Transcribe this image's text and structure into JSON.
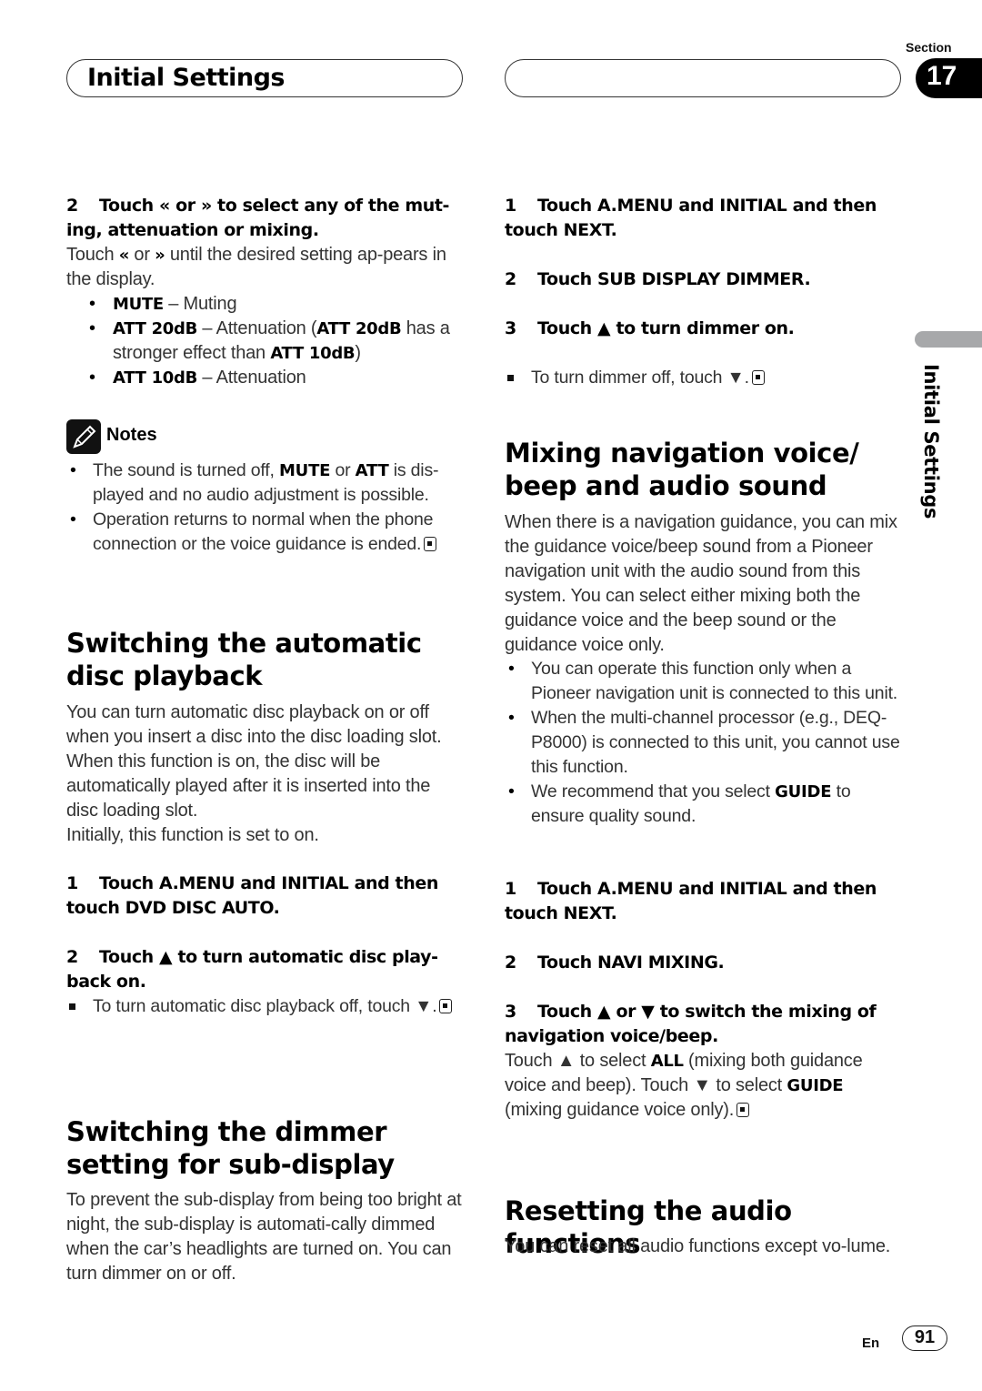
{
  "header": {
    "title": "Initial Settings",
    "section_label": "Section",
    "section_number": "17"
  },
  "side_tab": {
    "label": "Initial Settings"
  },
  "left_column": {
    "step2": {
      "num": "2",
      "text_a": "Touch ",
      "icon_prev": "«",
      "text_b": " or ",
      "icon_next": "»",
      "text_c": " to select any of the mut-ing, attenuation or mixing."
    },
    "step2_body": {
      "a": "Touch ",
      "prev": "«",
      "b": " or ",
      "next": "»",
      "c": " until the desired setting ap-pears in the display."
    },
    "options": [
      {
        "term": "MUTE",
        "desc": " – Muting"
      },
      {
        "term": "ATT 20dB",
        "desc": " – Attenuation (",
        "term2": "ATT 20dB",
        "desc2": " has a stronger effect than ",
        "term3": "ATT 10dB",
        "desc3": ")"
      },
      {
        "term": "ATT 10dB",
        "desc": " – Attenuation"
      }
    ],
    "notes": {
      "title": "Notes",
      "items": [
        {
          "a": "The sound is turned off, ",
          "b1": "MUTE",
          "c": " or ",
          "b2": "ATT",
          "d": " is dis-played and no audio adjustment is possible."
        },
        {
          "a": "Operation returns to normal when the phone connection or the voice guidance is ended."
        }
      ]
    },
    "auto_disc": {
      "heading": "Switching the automatic disc playback",
      "body": "You can turn automatic disc playback on or off when you insert a disc into the disc loading slot. When this function is on, the disc will be automatically played after it is inserted into the disc loading slot.",
      "body2": "Initially, this function is set to on.",
      "step1_num": "1",
      "step1": "Touch A.MENU and INITIAL and then touch DVD DISC AUTO.",
      "step2_num": "2",
      "step2": "Touch ▲ to turn automatic disc play-back on.",
      "note": "To turn automatic disc playback off, touch ▼."
    },
    "dimmer": {
      "heading": "Switching the dimmer setting for sub-display",
      "body": "To prevent the sub-display from being too bright at night, the sub-display is automati-cally dimmed when the car’s headlights are turned on. You can turn dimmer on or off."
    }
  },
  "right_column": {
    "dimmer_steps": {
      "step1_num": "1",
      "step1": "Touch A.MENU and INITIAL and then touch NEXT.",
      "step2_num": "2",
      "step2": "Touch SUB DISPLAY DIMMER.",
      "step3_num": "3",
      "step3": "Touch ▲ to turn dimmer on.",
      "note": "To turn dimmer off, touch ▼."
    },
    "mixing": {
      "heading": "Mixing navigation voice/ beep and audio sound",
      "body": "When there is a navigation guidance, you can mix the guidance voice/beep sound from a Pioneer navigation unit with the audio sound from this system. You can select either mixing both the guidance voice and the beep sound or the guidance voice only.",
      "bullets": [
        {
          "a": "You can operate this function only when a Pioneer navigation unit is connected to this unit."
        },
        {
          "a": "When the multi-channel processor (e.g., DEQ-P8000) is connected to this unit, you cannot use this function."
        },
        {
          "a": "We recommend that you select ",
          "b": "GUIDE",
          "c": " to ensure quality sound."
        }
      ],
      "step1_num": "1",
      "step1": "Touch A.MENU and INITIAL and then touch NEXT.",
      "step2_num": "2",
      "step2": "Touch NAVI MIXING.",
      "step3_num": "3",
      "step3": "Touch ▲ or ▼ to switch the mixing of navigation voice/beep.",
      "step3_body": {
        "a": "Touch ▲ to select ",
        "b1": "ALL",
        "c": " (mixing both guidance voice and beep). Touch ▼ to select ",
        "b2": "GUIDE",
        "d": " (mixing guidance voice only)."
      }
    },
    "reset": {
      "heading": "Resetting the audio functions",
      "body": "You can reset all audio functions except vo-lume."
    }
  },
  "footer": {
    "lang": "En",
    "page": "91"
  }
}
